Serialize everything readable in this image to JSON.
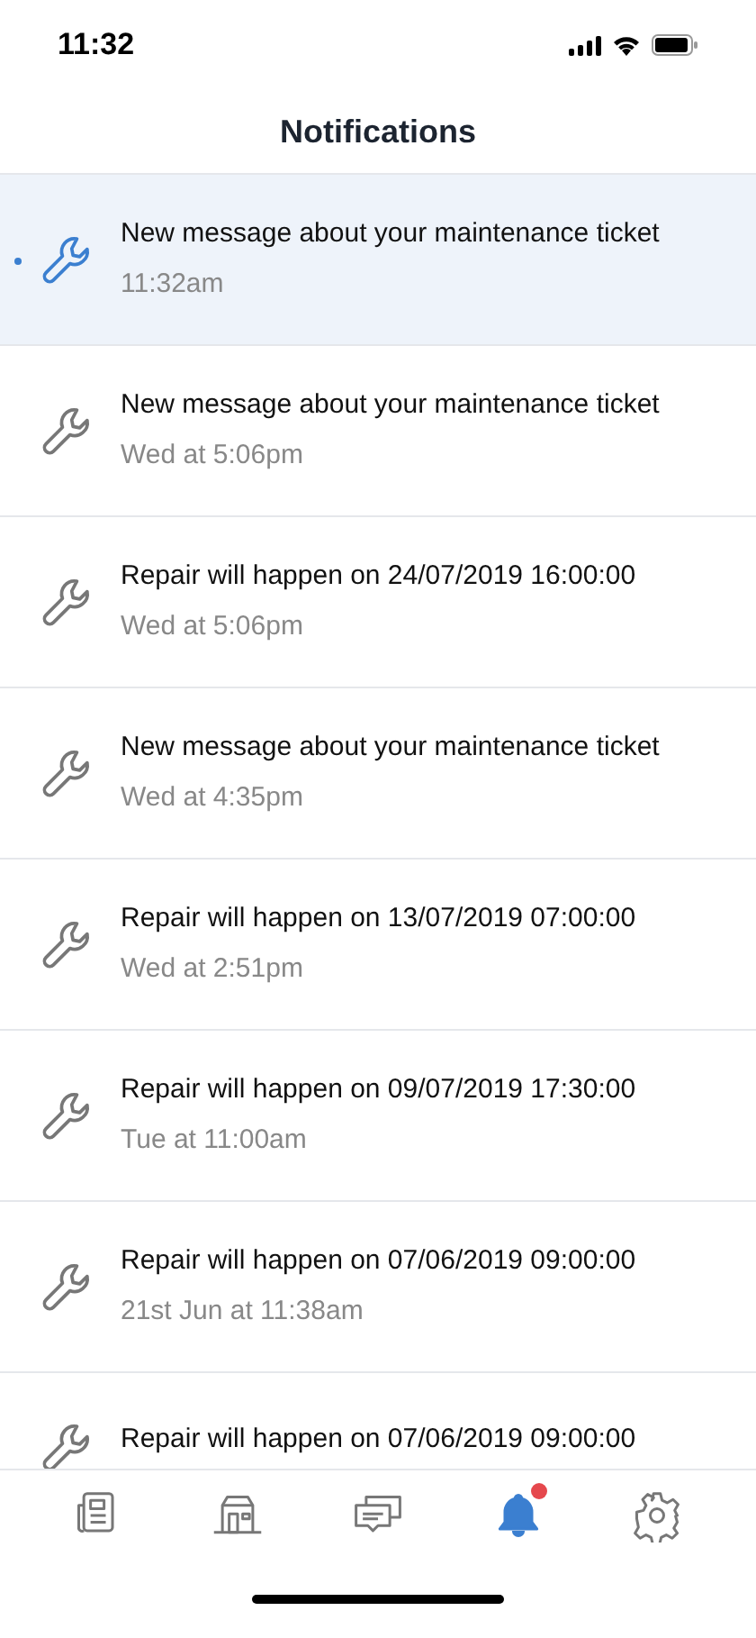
{
  "status_bar": {
    "time": "11:32"
  },
  "header": {
    "title": "Notifications"
  },
  "notifications": [
    {
      "title": "New message about your maintenance ticket",
      "time": "11:32am",
      "unread": true
    },
    {
      "title": "New message about your maintenance ticket",
      "time": "Wed at 5:06pm",
      "unread": false
    },
    {
      "title": "Repair will happen on 24/07/2019 16:00:00",
      "time": "Wed at 5:06pm",
      "unread": false
    },
    {
      "title": "New message about your maintenance ticket",
      "time": "Wed at 4:35pm",
      "unread": false
    },
    {
      "title": "Repair will happen on 13/07/2019 07:00:00",
      "time": "Wed at 2:51pm",
      "unread": false
    },
    {
      "title": "Repair will happen on 09/07/2019 17:30:00",
      "time": "Tue at 11:00am",
      "unread": false
    },
    {
      "title": "Repair will happen on 07/06/2019 09:00:00",
      "time": "21st Jun at 11:38am",
      "unread": false
    },
    {
      "title": "Repair will happen on 07/06/2019 09:00:00",
      "unread": false
    }
  ],
  "tab_bar": [
    {
      "kind": "news",
      "selected": false,
      "badge": false
    },
    {
      "kind": "store",
      "selected": false,
      "badge": false
    },
    {
      "kind": "chat",
      "selected": false,
      "badge": false
    },
    {
      "kind": "bell",
      "selected": true,
      "badge": true
    },
    {
      "kind": "gear",
      "selected": false,
      "badge": false
    }
  ]
}
